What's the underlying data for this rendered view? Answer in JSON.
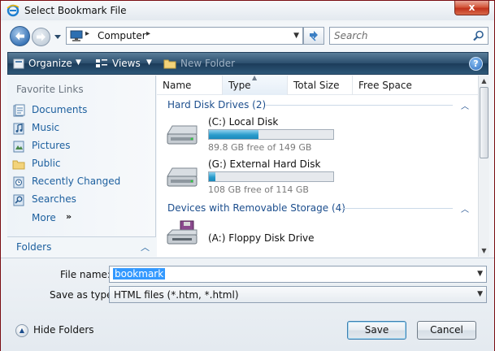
{
  "window": {
    "title": "Select Bookmark File",
    "close_glyph": "x",
    "close_button_color": "#c1321c"
  },
  "address": {
    "location": "Computer",
    "separator": "▸",
    "search_placeholder": "Search"
  },
  "toolbar": {
    "organize": "Organize",
    "views": "Views",
    "new_folder": "New Folder",
    "help_glyph": "?"
  },
  "sidebar": {
    "favorites_header": "Favorite Links",
    "items": [
      {
        "label": "Documents",
        "icon": "documents-icon"
      },
      {
        "label": "Music",
        "icon": "music-icon"
      },
      {
        "label": "Pictures",
        "icon": "pictures-icon"
      },
      {
        "label": "Public",
        "icon": "public-folder-icon"
      },
      {
        "label": "Recently Changed",
        "icon": "recently-changed-icon"
      },
      {
        "label": "Searches",
        "icon": "searches-icon"
      }
    ],
    "more": "More",
    "more_arrows": "»",
    "folders": "Folders"
  },
  "columns": [
    "Name",
    "Type",
    "Total Size",
    "Free Space"
  ],
  "groups": [
    {
      "title": "Hard Disk Drives (2)",
      "drives": [
        {
          "name": "(C:) Local Disk",
          "free_text": "89.8 GB free of 149 GB",
          "used_fraction": 0.4
        },
        {
          "name": "(G:) External Hard Disk",
          "free_text": "108 GB free of 114 GB",
          "used_fraction": 0.05
        }
      ]
    },
    {
      "title": "Devices with Removable Storage (4)",
      "drives": [
        {
          "name": "(A:) Floppy Disk Drive"
        }
      ]
    }
  ],
  "form": {
    "file_name_label": "File name:",
    "file_name_value": "bookmark",
    "save_as_label": "Save as type:",
    "save_as_value": "HTML files (*.htm, *.html)"
  },
  "footer": {
    "hide_folders": "Hide Folders",
    "save": "Save",
    "cancel": "Cancel"
  },
  "colors": {
    "toolbar": "#2b4e6d",
    "link": "#1c5f9e",
    "selection": "#3399ff",
    "background_frame": "#c4101c"
  }
}
